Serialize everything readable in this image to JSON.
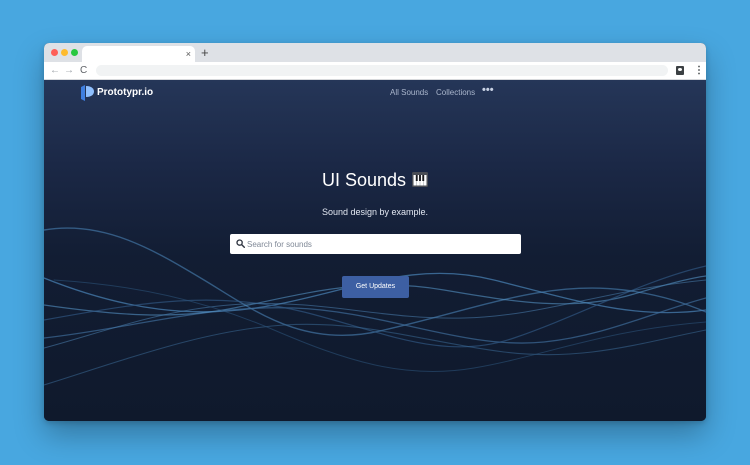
{
  "browser": {
    "tab_close_glyph": "×",
    "new_tab_glyph": "+",
    "back_glyph": "←",
    "forward_glyph": "→",
    "reload_glyph": "C",
    "menu_glyph": "⋮",
    "icons": [
      "back-arrow-icon",
      "forward-arrow-icon",
      "reload-icon",
      "account-icon",
      "menu-kebab-icon",
      "tab-close-icon",
      "new-tab-icon"
    ]
  },
  "site": {
    "brand": "Prototypr.io",
    "nav": {
      "all_sounds": "All Sounds",
      "collections": "Collections",
      "more": "•••"
    },
    "hero": {
      "title": "UI Sounds",
      "title_icon": "piano-icon",
      "subtitle": "Sound design by example."
    },
    "search": {
      "placeholder": "Search for sounds",
      "value": "",
      "icon": "search-icon"
    },
    "cta": {
      "label": "Get Updates"
    }
  },
  "colors": {
    "backdrop": "#48a7e0",
    "page_top": "#253658",
    "page_bottom": "#0f192c",
    "button": "#3d5fa3",
    "logo_accent": "#3f7fe0",
    "wave": "#4a7fae"
  }
}
